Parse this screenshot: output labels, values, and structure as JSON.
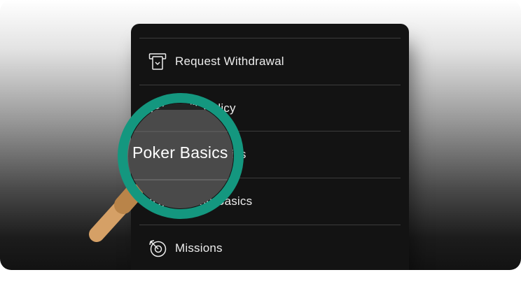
{
  "menu": {
    "items": [
      {
        "label": "Request Withdrawal",
        "icon": "atm-withdrawal-icon"
      },
      {
        "label": "RNT Policy",
        "icon": "policy-icon"
      },
      {
        "label": "Poker Basics",
        "icon": "cards-icon"
      },
      {
        "label": "Casino Basics",
        "icon": "chip-icon"
      },
      {
        "label": "Missions",
        "icon": "target-dart-icon"
      }
    ]
  },
  "magnifier": {
    "text": "Poker Basics",
    "ring_color": "#14977f",
    "handle_color": "#d5a066",
    "icon": "magnifying-glass-icon"
  },
  "colors": {
    "panel_background": "#131313",
    "text": "#ececec",
    "divider": "#3c3c3c"
  }
}
